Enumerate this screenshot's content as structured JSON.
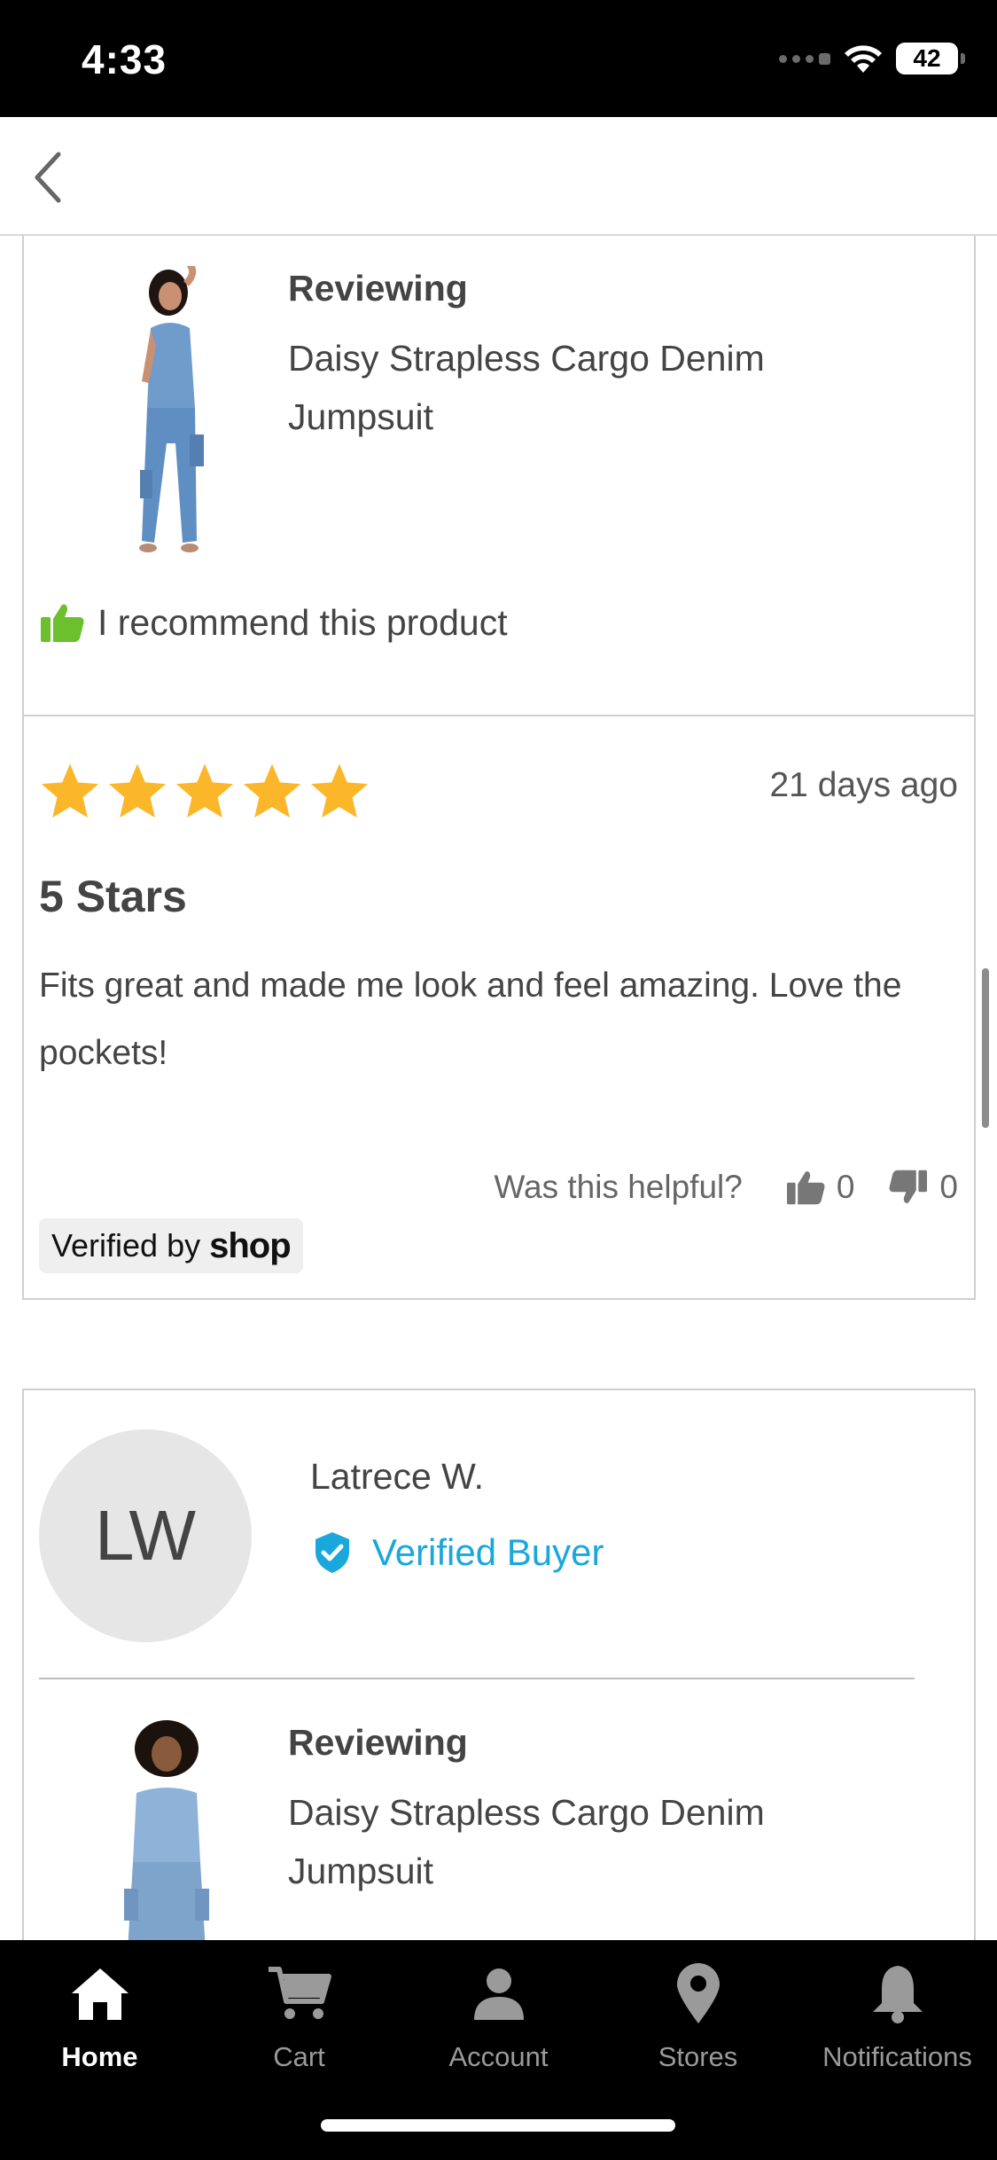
{
  "status_bar": {
    "time": "4:33",
    "battery": "42"
  },
  "review1": {
    "reviewing_label": "Reviewing",
    "product_name": "Daisy Strapless Cargo Denim Jumpsuit",
    "recommend_text": "I recommend this product",
    "rating": 5,
    "date": "21 days ago",
    "title": "5 Stars",
    "body": "Fits great and made me look and feel amazing. Love the pockets!",
    "helpful_prompt": "Was this helpful?",
    "helpful_up": "0",
    "helpful_down": "0",
    "verified_prefix": "Verified by",
    "verified_brand": "shop"
  },
  "review2": {
    "avatar_initials": "LW",
    "reviewer_name": "Latrece W.",
    "verified_buyer": "Verified Buyer",
    "reviewing_label": "Reviewing",
    "product_name": "Daisy Strapless Cargo Denim Jumpsuit"
  },
  "tab_bar": {
    "tabs": [
      {
        "label": "Home",
        "icon": "home-icon",
        "active": true
      },
      {
        "label": "Cart",
        "icon": "cart-icon",
        "active": false
      },
      {
        "label": "Account",
        "icon": "person-icon",
        "active": false
      },
      {
        "label": "Stores",
        "icon": "map-pin-icon",
        "active": false
      },
      {
        "label": "Notifications",
        "icon": "bell-icon",
        "active": false
      }
    ]
  },
  "colors": {
    "star": "#fbb62a",
    "recommend_thumb": "#6cbf2d",
    "verified_blue": "#1aa7dc",
    "tab_active": "#ffffff",
    "tab_inactive": "#9a9a9a"
  }
}
